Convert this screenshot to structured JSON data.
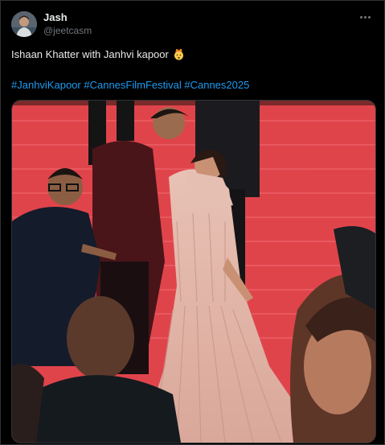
{
  "tweet": {
    "author": {
      "display_name": "Jash",
      "handle": "@jeetcasm"
    },
    "text": "Ishaan Khatter with Janhvi kapoor",
    "emoji": "exploding-head-emoji",
    "hashtags": [
      "#JanhviKapoor",
      "#CannesFilmFestival",
      "#Cannes2025"
    ]
  },
  "icons": {
    "more": "more-options-icon",
    "avatar": "user-avatar"
  },
  "colors": {
    "background": "#000000",
    "text": "#e7e9ea",
    "muted": "#71767b",
    "link": "#1d9bf0",
    "border": "#2f3336",
    "carpet": "#e8474f"
  }
}
